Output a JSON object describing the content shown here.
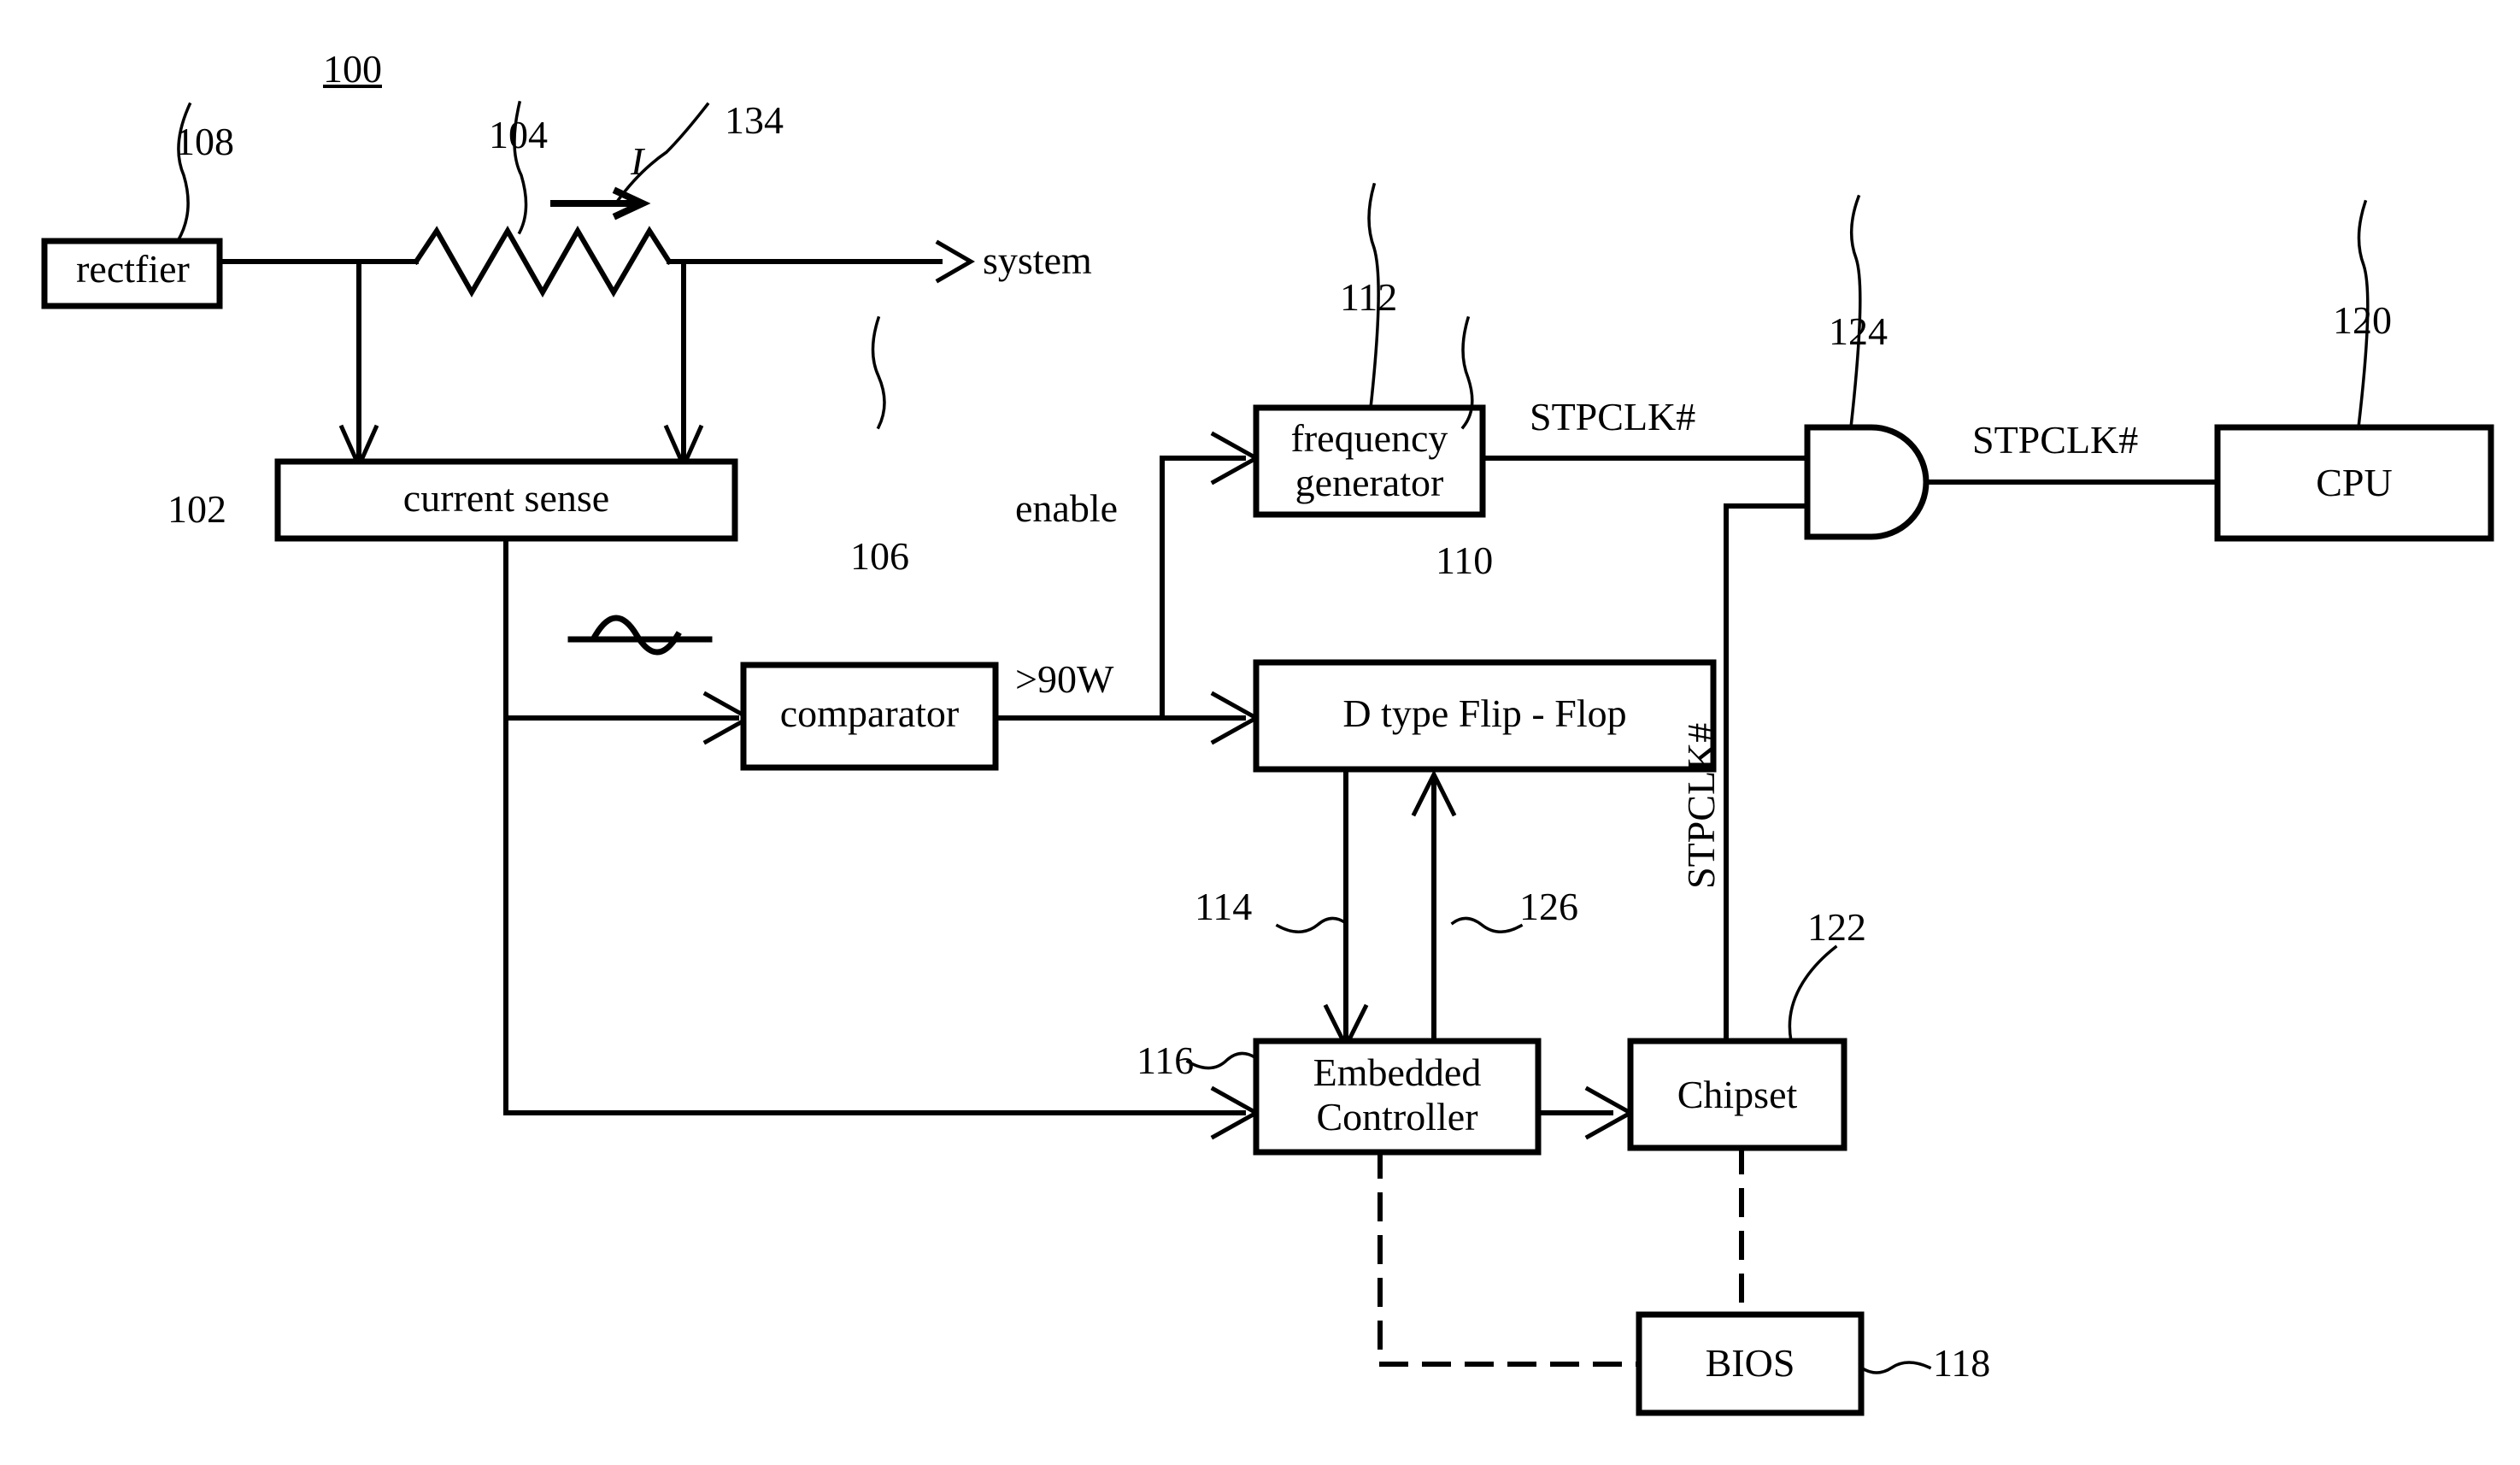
{
  "figure": {
    "title_number": "100",
    "domain": "patent-block-diagram"
  },
  "blocks": [
    {
      "id": "rectfier",
      "label": "rectfier",
      "ref": "108"
    },
    {
      "id": "current_sense",
      "label": "current sense",
      "ref": "102"
    },
    {
      "id": "comparator",
      "label": "comparator",
      "ref": "106"
    },
    {
      "id": "freq_gen",
      "label": "frequency\ngenerator",
      "ref": "112"
    },
    {
      "id": "dff",
      "label": "D type Flip - Flop",
      "ref": "110"
    },
    {
      "id": "cpu",
      "label": "CPU",
      "ref": "120"
    },
    {
      "id": "embedded",
      "label": "Embedded\nController",
      "ref": "116"
    },
    {
      "id": "chipset",
      "label": "Chipset",
      "ref": "122"
    },
    {
      "id": "bios",
      "label": "BIOS",
      "ref": "118"
    }
  ],
  "block_labels": {
    "rectfier": "rectfier",
    "current_sense": "current sense",
    "comparator": "comparator",
    "freq_gen_line1": "frequency",
    "freq_gen_line2": "generator",
    "dff": "D type Flip - Flop",
    "cpu": "CPU",
    "embedded_line1": "Embedded",
    "embedded_line2": "Controller",
    "chipset": "Chipset",
    "bios": "BIOS"
  },
  "reference_numerals": {
    "figure": "100",
    "rectfier": "108",
    "resistor": "104",
    "current_arrow": "134",
    "current_sense": "102",
    "comparator": "106",
    "freq_gen": "112",
    "dff": "110",
    "and_gate": "124",
    "cpu": "120",
    "line_114": "114",
    "line_126": "126",
    "embedded": "116",
    "chipset": "122",
    "bios": "118"
  },
  "signal_labels": {
    "current_symbol": "I",
    "system_out": "system",
    "enable": "enable",
    "threshold": ">90W",
    "stpclk_gate_in": "STPCLK#",
    "stpclk_cpu": "STPCLK#",
    "stpclk_vertical": "STPCLK#"
  },
  "icons": {
    "resistor": "resistor-zigzag-icon",
    "ac_wave": "sine-wave-icon",
    "and_gate": "and-gate-icon",
    "arrow": "arrow-head-icon"
  },
  "colors": {
    "line": "#000000",
    "background": "#ffffff",
    "text": "#000000"
  }
}
